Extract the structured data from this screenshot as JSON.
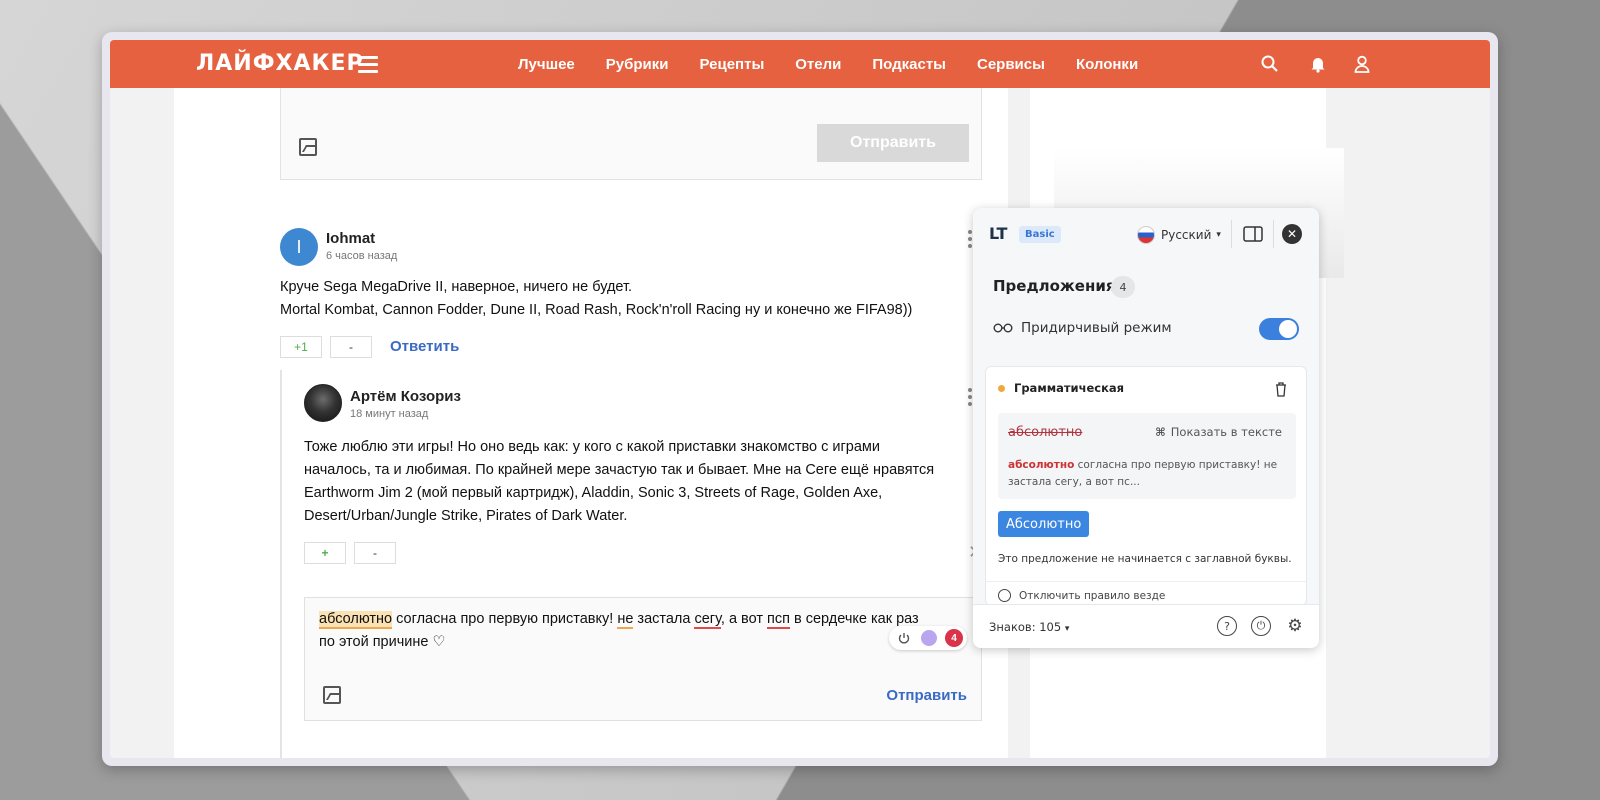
{
  "site": {
    "logo": "ЛАЙФХАКЕР",
    "nav": [
      "Лучшее",
      "Рубрики",
      "Рецепты",
      "Отели",
      "Подкасты",
      "Сервисы",
      "Колонки"
    ]
  },
  "comment_form_top": {
    "send_label": "Отправить"
  },
  "comment1": {
    "avatar_letter": "I",
    "author": "Iohmat",
    "time": "6 часов назад",
    "text_line1": "Круче Sega MegaDrive II, наверное, ничего не будет.",
    "text_line2": "Mortal Kombat, Cannon Fodder, Dune II, Road Rash, Rock'n'roll Racing ну и конечно же FIFA98))",
    "vote_plus": "+1",
    "vote_minus": "-",
    "reply": "Ответить"
  },
  "comment2": {
    "author": "Артём Козориз",
    "time": "18 минут назад",
    "text_line1": "Тоже люблю эти игры! Но оно ведь как: у кого с какой приставки знакомство с играми",
    "text_line2": "началось, та и любимая. По крайней мере зачастую так и бывает. Мне на Сеге ещё нравятся",
    "text_line3": "Earthworm Jim 2 (мой первый картридж), Aladdin, Sonic 3, Streets of Rage, Golden Axe,",
    "text_line4": "Desert/Urban/Jungle Strike, Pirates of Dark Water.",
    "vote_plus": "+",
    "vote_minus": "-"
  },
  "editor": {
    "w1": "абсолютно",
    "t1": " согласна про первую приставку! ",
    "w2": "не",
    "t2": " застала ",
    "w3": "сегу",
    "t3": ", а вот ",
    "w4": "псп",
    "t4": " в сердечке как раз",
    "t5": "по этой причине ♡",
    "badge_count": "4",
    "send_label": "Отправить"
  },
  "lt_panel": {
    "logo": "LT",
    "plan": "Basic",
    "language": "Русский",
    "title": "Предложения",
    "count": "4",
    "picky_mode": "Придирчивый режим",
    "picky_mode_on": true,
    "card": {
      "category": "Грамматическая",
      "wrong_word": "абсолютно",
      "show_in_text": "Показать в тексте",
      "context_bold": "абсолютно",
      "context_rest": " согласна про первую приставку! не застала сегу, а вот пс...",
      "fix": "Абсолютно",
      "message": "Это предложение не начинается с заглавной буквы.",
      "disable_rule": "Отключить правило везде"
    },
    "chars": "Знаков: 105"
  },
  "colors": {
    "brand": "#e5613f",
    "link": "#3b6ac4",
    "lt_accent": "#3b86e0",
    "error_red": "#d9344a"
  }
}
